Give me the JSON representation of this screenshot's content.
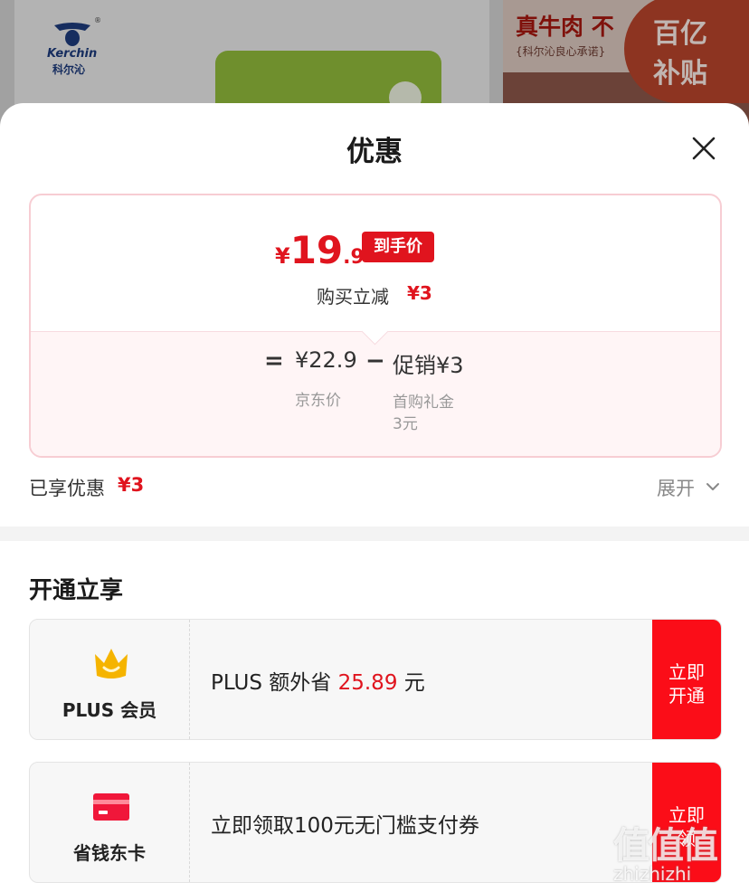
{
  "background": {
    "logo_text": "Kerchin",
    "logo_cn": "科尔沁",
    "logo_reg": "®",
    "banner_title": "真牛肉 不",
    "banner_subtitle": "{科尔沁良心承诺}",
    "badge_line1": "百亿",
    "badge_line2": "补贴"
  },
  "sheet": {
    "title": "优惠",
    "close_icon": "close-icon"
  },
  "price": {
    "currency": "¥",
    "final_int": "19",
    "final_dec": ".9",
    "badge": "到手价",
    "reduce_label": "购买立减",
    "reduce_amount": "¥3",
    "equals": "=",
    "jd_price": "¥22.9",
    "jd_label": "京东价",
    "minus": "−",
    "promo": "促销¥3",
    "promo_desc": "首购礼金",
    "promo_sub": "3元"
  },
  "enjoyed": {
    "label": "已享优惠",
    "amount": "¥3",
    "expand": "展开",
    "expand_icon": "chevron-down-icon"
  },
  "section": {
    "title": "开通立享"
  },
  "cards": [
    {
      "icon": "crown-icon",
      "name": "PLUS 会员",
      "text_prefix": "PLUS 额外省 ",
      "text_amount": "25.89",
      "text_suffix": " 元",
      "btn_line1": "立即",
      "btn_line2": "开通",
      "icon_color": "#f5b400"
    },
    {
      "icon": "card-icon",
      "name": "省钱东卡",
      "text_prefix": "立即领取100元无门槛支付券",
      "text_amount": "",
      "text_suffix": "",
      "btn_line1": "立即",
      "btn_line2": "领",
      "icon_color": "#f0173a"
    }
  ],
  "watermark": {
    "cn": "值值值",
    "en": "zhizhizhi"
  },
  "colors": {
    "accent": "#e0141e",
    "button": "#fb0d18"
  }
}
